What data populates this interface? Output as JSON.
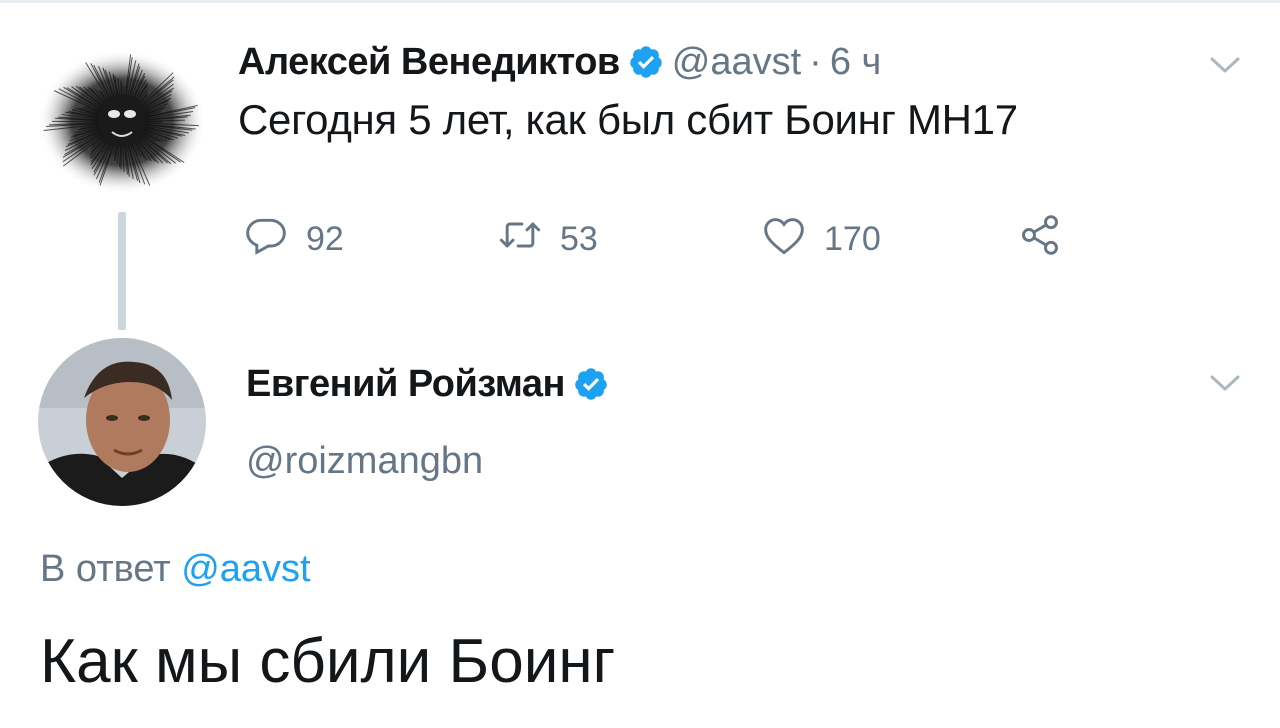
{
  "tweet1": {
    "author_name": "Алексей Венедиктов",
    "handle": "@aavst",
    "separator": "·",
    "time": "6 ч",
    "text": "Сегодня 5 лет, как был сбит Боинг МН17",
    "actions": {
      "replies": "92",
      "retweets": "53",
      "likes": "170"
    }
  },
  "tweet2": {
    "author_name": "Евгений Ройзман",
    "handle": "@roizmangbn",
    "reply_prefix": "В ответ",
    "reply_to": "@aavst",
    "text": "Как мы сбили Боинг"
  },
  "colors": {
    "verified": "#1da1f2",
    "secondary_text": "#657786",
    "link": "#1da1f2",
    "thread_line": "#ccd6dd"
  },
  "icons": [
    "verified-badge-icon",
    "chevron-down-icon",
    "reply-icon",
    "retweet-icon",
    "like-icon",
    "share-icon"
  ]
}
